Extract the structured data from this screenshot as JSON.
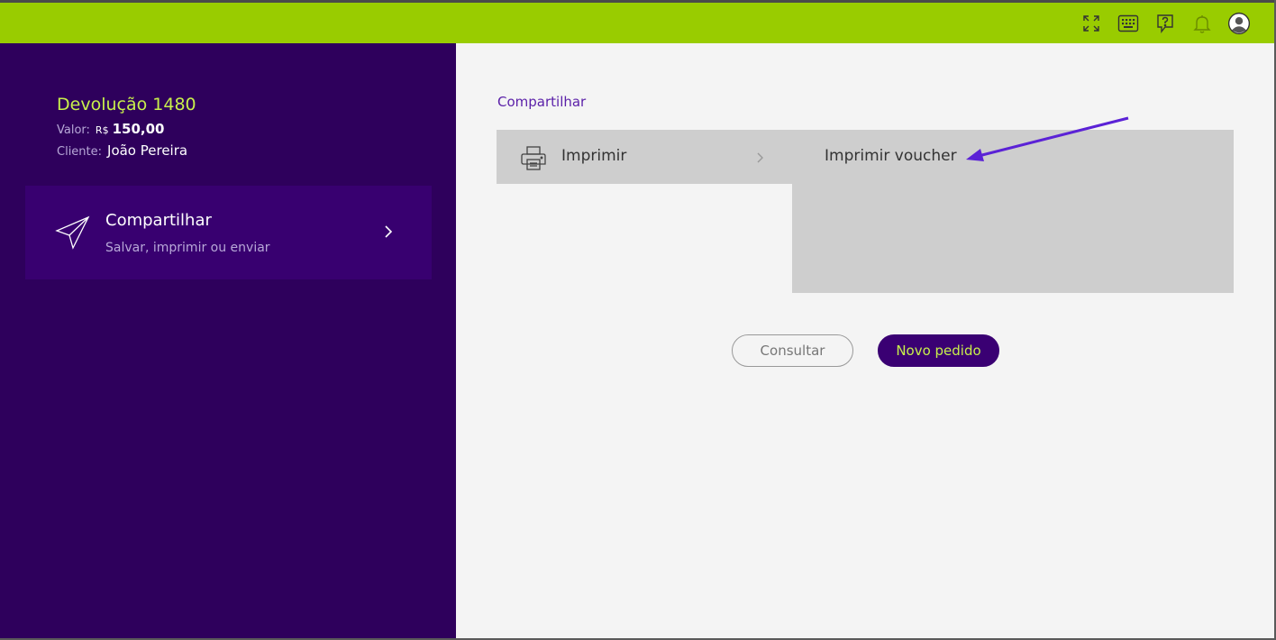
{
  "topbar": {
    "bg_color": "#99cc00",
    "icons": [
      "fullscreen-icon",
      "keyboard-icon",
      "help-icon",
      "bell-icon",
      "user-avatar-icon"
    ]
  },
  "sidebar": {
    "bg_color": "#2e005c",
    "order": {
      "title": "Devolução 1480",
      "valor_label": "Valor:",
      "currency": "R$",
      "amount": "150,00",
      "cliente_label": "Cliente:",
      "cliente_name": "João Pereira"
    },
    "share_card": {
      "icon": "paper-plane-icon",
      "title": "Compartilhar",
      "subtitle": "Salvar, imprimir ou enviar"
    }
  },
  "main": {
    "section_label": "Compartilhar",
    "menu": {
      "icon": "printer-icon",
      "label": "Imprimir"
    },
    "submenu": {
      "item_label": "Imprimir voucher"
    },
    "buttons": {
      "consultar": "Consultar",
      "novo_pedido": "Novo pedido"
    }
  },
  "colors": {
    "accent_green": "#99cc00",
    "title_lime": "#c8f04b",
    "purple_dark": "#2e005c",
    "purple_button": "#3a0073",
    "annotation_arrow": "#5b22d6"
  }
}
